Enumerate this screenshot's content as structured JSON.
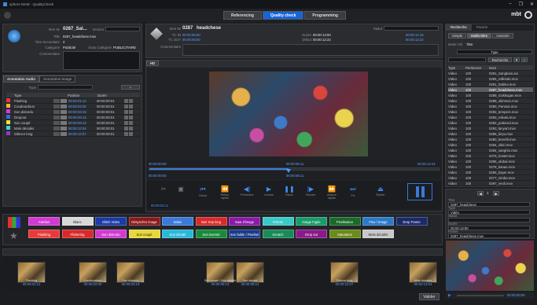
{
  "window": {
    "title": "sphere MAM - QualityCheck",
    "controls": [
      "–",
      "❐",
      "✕"
    ]
  },
  "nav": {
    "tabs": [
      "Referencing",
      "Quality check",
      "Programming"
    ],
    "active": 1,
    "brand": "mbt"
  },
  "asset": {
    "fields": [
      {
        "label": "Item Nr",
        "value": "0287_Sal..."
      },
      {
        "label": "Title",
        "value": "0287_headchese.mov"
      },
      {
        "label": "Titre Secondaire",
        "value": "2"
      },
      {
        "label": "Catégorie",
        "value": "Publicité"
      },
      {
        "label": "Sous Catégorie",
        "value": "PUBLICITAIRE"
      },
      {
        "label": "Commentaire",
        "value": ""
      }
    ],
    "version_label": "Version"
  },
  "media": {
    "id_label": "Item Nr",
    "id_value": "0287",
    "title": "headchese",
    "tc_in_label": "TC IN",
    "tc_in": "00:00:00:00",
    "tc_out_label": "TC OUT",
    "tc_out": "00:00:00:00",
    "duration_label": "Durée",
    "duration": "00:00:13:00",
    "start_label": "Début",
    "start": "00:00:12:23",
    "status_label": "Statut",
    "commentaire_label": "Commentaire",
    "tc_right_in": "00:00:12:18",
    "tc_right_out": "00:00:12:22"
  },
  "annotations": {
    "tabs": [
      "Annotation Audio",
      "Annotation Image"
    ],
    "filter_label": "Type",
    "columns": [
      "Type",
      "Position",
      "Durée"
    ],
    "rows": [
      {
        "type": "Flashing",
        "position": "00:00:01:12",
        "duration": "00:00:00:01",
        "color": "#e8343a"
      },
      {
        "type": "Coudourdoun",
        "position": "00:00:02:00",
        "duration": "00:00:00:01",
        "color": "#f2b23a"
      },
      {
        "type": "Son distordu",
        "position": "00:00:03:19",
        "duration": "00:00:00:01",
        "color": "#d43ad8"
      },
      {
        "type": "Dropout",
        "position": "00:00:06:13",
        "duration": "00:00:00:01",
        "color": "#3a6ad8"
      },
      {
        "type": "Son coupé",
        "position": "00:00:09:13",
        "duration": "00:00:00:01",
        "color": "#f2e63a"
      },
      {
        "type": "Mots décalés",
        "position": "00:00:12:04",
        "duration": "00:00:00:01",
        "color": "#3ad8d8"
      },
      {
        "type": "Silence long",
        "position": "00:00:12:07",
        "duration": "00:00:00:01",
        "color": "#8a3ac8"
      }
    ]
  },
  "player": {
    "tab": "HD",
    "tc_left": "00:00:00:00",
    "tc_mid": "00:00:06:11",
    "tc_right": "00:00:12:24",
    "progress": 0.48,
    "tc_current": "00:00:06:11",
    "tc_left2": "00:00:00:00",
    "tc_jog": "00:00:03:11",
    "controls": [
      "Début",
      "Retour rapide",
      "Précédent",
      "Lecture",
      "Pause",
      "Suivant",
      "Avance rapide",
      "Fin",
      "Éjecter"
    ]
  },
  "tags_row1": [
    {
      "label": "Artefact",
      "color": "#d03ad0"
    },
    {
      "label": "Blanc",
      "color": "#d8d8d8"
    },
    {
      "label": "Glitch Video",
      "color": "#1a3aa8"
    },
    {
      "label": "Désynchro image",
      "color": "#8a1a1a"
    },
    {
      "label": "Noise",
      "color": "#3a7ad8"
    },
    {
      "label": "Noir trop long",
      "color": "#d82a2a"
    },
    {
      "label": "Saut d'image",
      "color": "#8a1aa8"
    },
    {
      "label": "Freeze",
      "color": "#3ac8c8"
    },
    {
      "label": "Image Figée",
      "color": "#1a9a6a"
    },
    {
      "label": "Pixelisation",
      "color": "#1a6a2a"
    },
    {
      "label": "Flou / Image",
      "color": "#2a7ac8"
    },
    {
      "label": "Drop Frame",
      "color": "#1a2a6a"
    }
  ],
  "tags_row2": [
    {
      "label": "Flashing",
      "color": "#e83a3a"
    },
    {
      "label": "Flickering",
      "color": "#d82a2a"
    },
    {
      "label": "Son distordu",
      "color": "#d03ad0"
    },
    {
      "label": "Son coupé",
      "color": "#e8d83a"
    },
    {
      "label": "Son décalé",
      "color": "#2ab8d8"
    },
    {
      "label": "Son inversé",
      "color": "#1a8a3a"
    },
    {
      "label": "Son faible / Pixelisé",
      "color": "#1a3a8a"
    },
    {
      "label": "Scratch",
      "color": "#1a8a5a"
    },
    {
      "label": "Drop out",
      "color": "#8a1a8a"
    },
    {
      "label": "Saturation",
      "color": "#6a8a1a"
    },
    {
      "label": "Mots décalés",
      "color": "#c8c8c8"
    }
  ],
  "timeline": {
    "thumbs": [
      {
        "label": "Flashing",
        "tc": "00:00:01:12"
      },
      {
        "label": "Coudourdoun",
        "tc": "00:00:02:00"
      },
      {
        "label": "Son distordu",
        "tc": "00:00:03:19"
      },
      {
        "label": "Son coupé / Son décalé",
        "tc": "00:00:09:13"
      },
      {
        "label": "Son décalé",
        "tc": "00:00:09:21"
      },
      {
        "label": "Silence long",
        "tc": "00:00:12:07"
      },
      {
        "label": "Mots décalés",
        "tc": "00:00:12:04"
      }
    ],
    "validate": "Valider"
  },
  "right": {
    "tabs": [
      "Recherche",
      "Favoris"
    ],
    "subtabs": [
      "Simple",
      "Multicritère",
      "Avancée"
    ],
    "mode_label": "Mode Clé",
    "mode_value": "Titre",
    "type_value": "Type",
    "search_btn": "Recherche",
    "columns": [
      "Type",
      "Pertinence",
      "Nom"
    ],
    "rows": [
      {
        "type": "Video",
        "rel": "100",
        "name": "0291_Sanghani.avi"
      },
      {
        "type": "Video",
        "rel": "100",
        "name": "0285_milkiraki.mov"
      },
      {
        "type": "Video",
        "rel": "100",
        "name": "0281_habitui.mov"
      },
      {
        "type": "Video",
        "rel": "100",
        "name": "0287_headchese.mov"
      },
      {
        "type": "Video",
        "rel": "100",
        "name": "0289_Gokkugan.mov"
      },
      {
        "type": "Video",
        "rel": "100",
        "name": "0288_slimmon.mov"
      },
      {
        "type": "Video",
        "rel": "100",
        "name": "0290_Panosa.mov"
      },
      {
        "type": "Video",
        "rel": "100",
        "name": "0292_tempere.mov"
      },
      {
        "type": "Video",
        "rel": "100",
        "name": "0283_mikuta.mov"
      },
      {
        "type": "Video",
        "rel": "100",
        "name": "0282_pottered.mov"
      },
      {
        "type": "Video",
        "rel": "100",
        "name": "0293_lanyart.mov"
      },
      {
        "type": "Video",
        "rel": "100",
        "name": "0286_kiryu.mov"
      },
      {
        "type": "Video",
        "rel": "100",
        "name": "0280_benefit.mov"
      },
      {
        "type": "Video",
        "rel": "100",
        "name": "0284_vikiri.mov"
      },
      {
        "type": "Video",
        "rel": "100",
        "name": "0294_sanghin.mov"
      },
      {
        "type": "Video",
        "rel": "100",
        "name": "0279_hostel.mov"
      },
      {
        "type": "Video",
        "rel": "100",
        "name": "0295_ulubai.mov"
      },
      {
        "type": "Video",
        "rel": "100",
        "name": "0278_kanae.mov"
      },
      {
        "type": "Video",
        "rel": "100",
        "name": "0296_bayer.mov"
      },
      {
        "type": "Video",
        "rel": "100",
        "name": "0277_nimba.mov"
      },
      {
        "type": "Video",
        "rel": "100",
        "name": "0297_veoli.mov"
      }
    ],
    "selected_row": 3,
    "page": "1",
    "details": [
      {
        "label": "Titre",
        "value": "0287_headchese"
      },
      {
        "label": "Type",
        "value": "Vidéo"
      },
      {
        "label": "Statut",
        "value": ""
      },
      {
        "label": "Durée",
        "value": "00:00:13:00"
      },
      {
        "label": "Fichier",
        "value": "0287_headchese.mov"
      }
    ],
    "preview_tc": "00:00:00:00"
  }
}
